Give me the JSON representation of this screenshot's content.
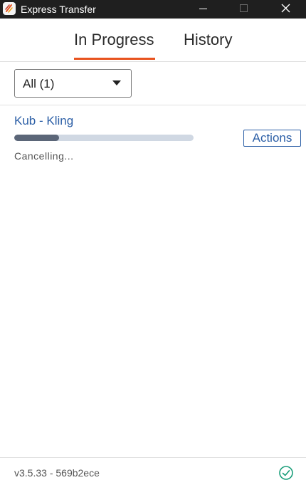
{
  "window": {
    "title": "Express Transfer",
    "icon": "express-transfer-logo-icon",
    "controls": [
      "minimize-icon",
      "maximize-icon",
      "close-icon"
    ]
  },
  "tabs": [
    {
      "label": "In Progress",
      "active": true
    },
    {
      "label": "History",
      "active": false
    }
  ],
  "filter": {
    "selected": "All (1)"
  },
  "transfers": [
    {
      "name": "Kub - Kling",
      "progress_fraction": 0.25,
      "status": "Cancelling...",
      "actions_label": "Actions"
    }
  ],
  "footer": {
    "version": "v3.5.33 - 569b2ece",
    "status_icon": "check-circle-icon"
  },
  "colors": {
    "accent_tab_underline": "#e8531f",
    "link_blue": "#2b5ea6",
    "progress_fill": "#5b6678",
    "progress_track": "#d0d8e3",
    "status_ok_green": "#1a9e7a",
    "titlebar_bg": "#1f1f1f"
  }
}
